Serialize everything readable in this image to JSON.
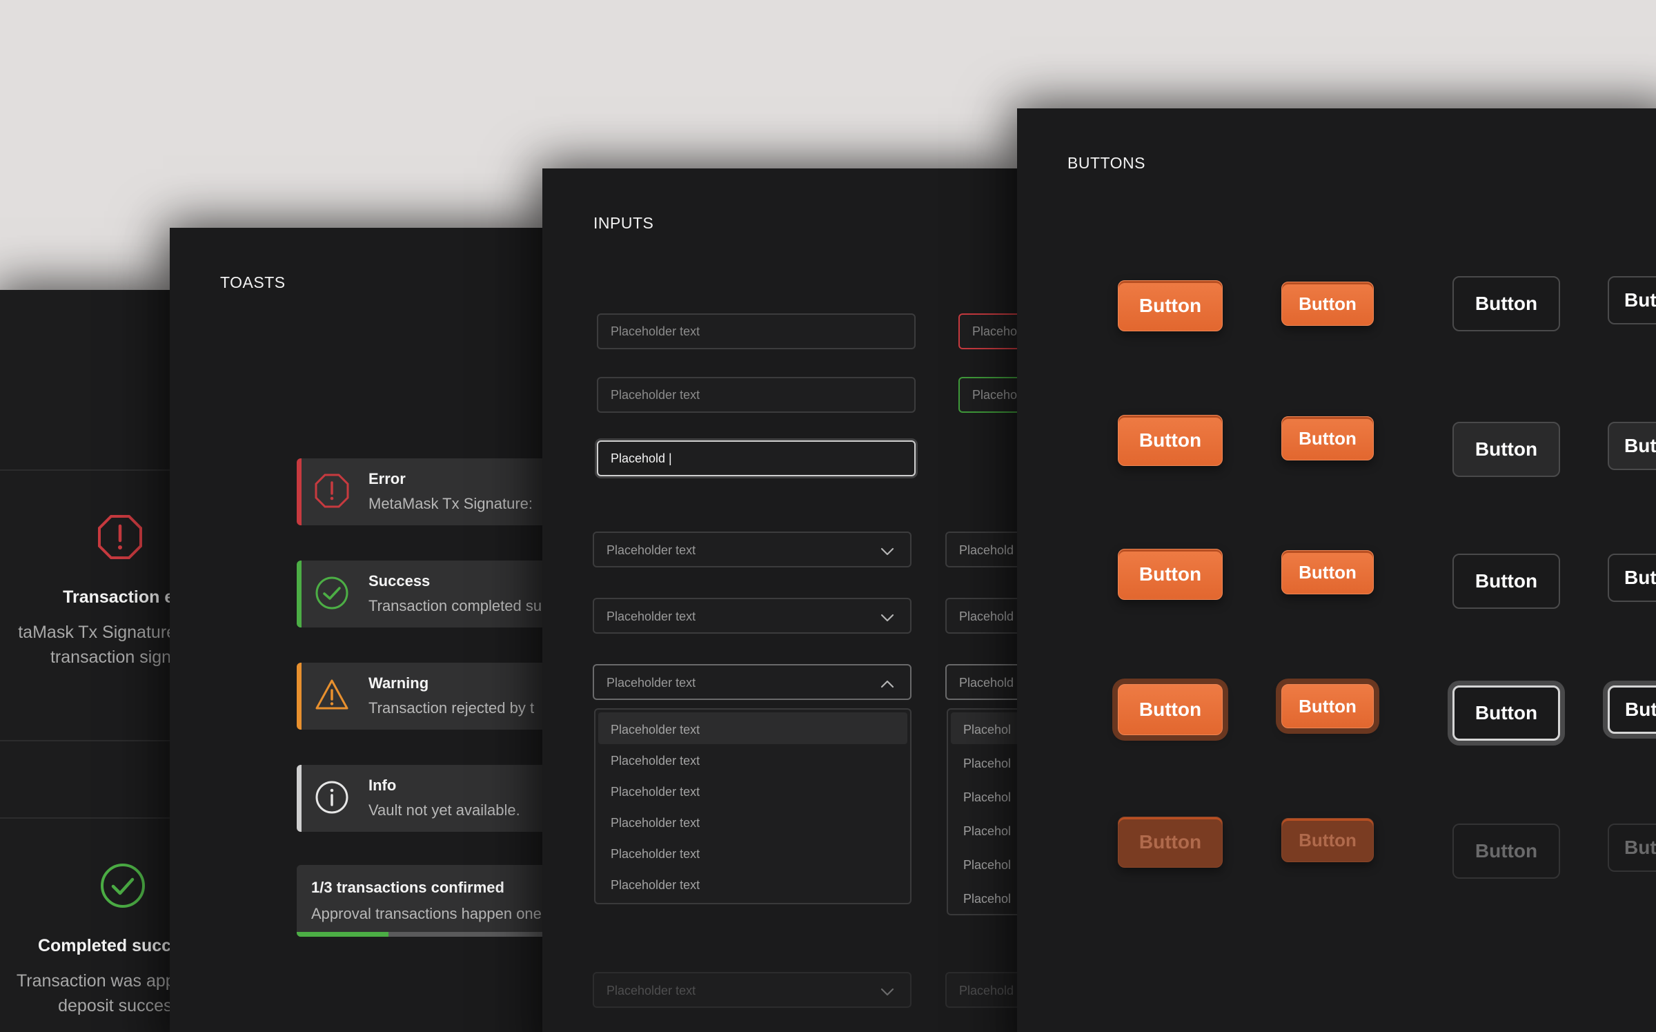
{
  "colors": {
    "background": "#e1dedd",
    "panel": "#1b1b1c",
    "error": "#c73a3f",
    "success": "#4cae45",
    "warning": "#e8902e",
    "info": "#d0d0d0",
    "accent": "#e8703a"
  },
  "modals": {
    "error": {
      "icon": "octagon-alert-icon",
      "title": "Transaction er",
      "line1": "taMask Tx Signature:",
      "line2": "transaction signa"
    },
    "success": {
      "icon": "check-circle-icon",
      "title": "Completed succe",
      "line1": "Transaction was appr",
      "line2": "deposit success"
    }
  },
  "toasts": {
    "title": "TOASTS",
    "items": [
      {
        "type": "error",
        "icon": "octagon-alert-icon",
        "title": "Error",
        "message": "MetaMask Tx Signature:"
      },
      {
        "type": "success",
        "icon": "check-circle-icon",
        "title": "Success",
        "message": "Transaction completed su"
      },
      {
        "type": "warning",
        "icon": "warning-triangle-icon",
        "title": "Warning",
        "message": "Transaction rejected by t"
      },
      {
        "type": "info",
        "icon": "info-circle-icon",
        "title": "Info",
        "message": "Vault not yet available."
      }
    ],
    "progress": {
      "title": "1/3 transactions confirmed",
      "message": "Approval transactions happen one",
      "fraction": 0.333
    }
  },
  "inputs": {
    "title": "INPUTS",
    "text_fields": [
      {
        "placeholder": "Placeholder text",
        "value": ""
      },
      {
        "placeholder": "Placeholder text",
        "value": ""
      },
      {
        "placeholder": "Placeholder text",
        "value": "Placehold |"
      }
    ],
    "text_fields_right": [
      {
        "placeholder": "Placeho",
        "state": "error"
      },
      {
        "placeholder": "Placeho",
        "state": "success"
      }
    ],
    "selects": [
      {
        "value": "Placeholder text",
        "state": "closed"
      },
      {
        "value": "Placeholder text",
        "state": "closed"
      },
      {
        "value": "Placeholder text",
        "state": "open"
      }
    ],
    "selects_right": [
      "Placehold",
      "Placehold",
      "Placehold"
    ],
    "dropdown_options": [
      "Placeholder text",
      "Placeholder text",
      "Placeholder text",
      "Placeholder text",
      "Placeholder text",
      "Placeholder text"
    ],
    "dropdown_options_right": [
      "Placehol",
      "Placehol",
      "Placehol",
      "Placehol",
      "Placehol",
      "Placehol"
    ],
    "disabled_select": {
      "value": "Placeholder text"
    },
    "disabled_select_right": {
      "value": "Placehold"
    }
  },
  "buttons": {
    "title": "BUTTONS",
    "label": "Button",
    "label_cut": "But",
    "rows": [
      "default",
      "hover",
      "pressed",
      "focus",
      "disabled"
    ]
  }
}
